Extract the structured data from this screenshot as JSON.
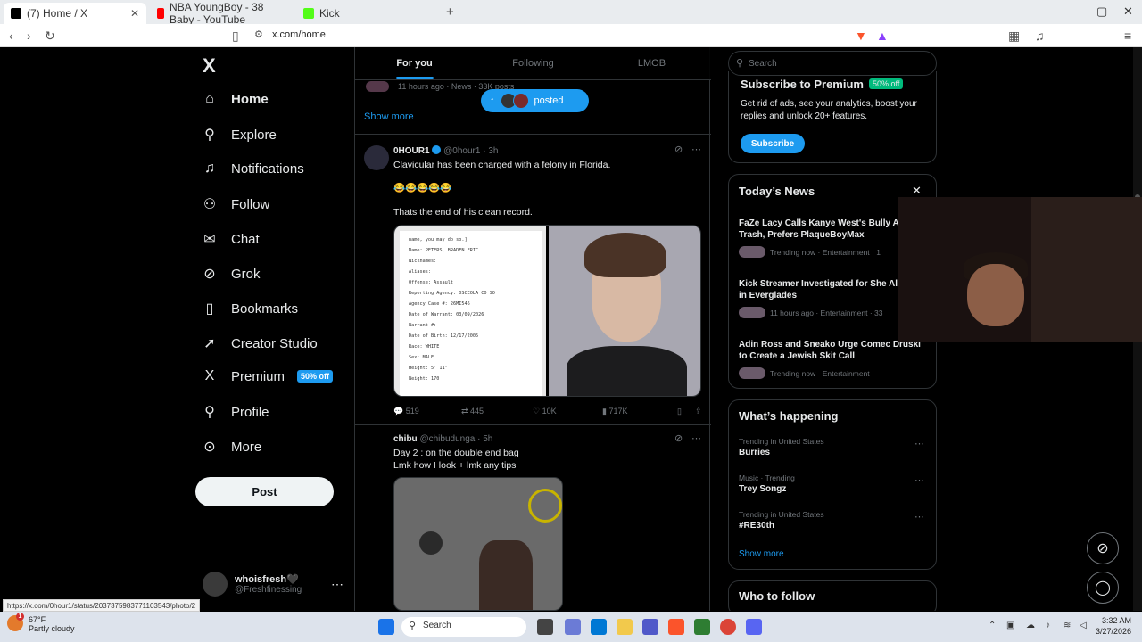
{
  "browser": {
    "tabs": [
      {
        "title": "(7) Home / X",
        "active": true,
        "favicon_color": "#000000"
      },
      {
        "title": "NBA YoungBoy - 38 Baby - YouTube",
        "active": false,
        "favicon_color": "#ff0000"
      },
      {
        "title": "Kick",
        "active": false,
        "favicon_color": "#53fc18"
      }
    ],
    "url": "x.com/home",
    "status_url": "https://x.com/0hour1/status/2037375983771103543/photo/2"
  },
  "sidebar": {
    "logo": "X",
    "items": [
      {
        "label": "Home",
        "icon": "home-icon",
        "glyph": "⌂",
        "bold": true
      },
      {
        "label": "Explore",
        "icon": "search-icon",
        "glyph": "⚲"
      },
      {
        "label": "Notifications",
        "icon": "bell-icon",
        "glyph": "🔔"
      },
      {
        "label": "Follow",
        "icon": "follow-icon",
        "glyph": "👤"
      },
      {
        "label": "Chat",
        "icon": "mail-icon",
        "glyph": "✉"
      },
      {
        "label": "Grok",
        "icon": "grok-icon",
        "glyph": "⊘"
      },
      {
        "label": "Bookmarks",
        "icon": "bookmark-icon",
        "glyph": "🔖"
      },
      {
        "label": "Creator Studio",
        "icon": "rocket-icon",
        "glyph": "🚀"
      },
      {
        "label": "Premium",
        "icon": "x-icon",
        "glyph": "X",
        "badge": "50% off"
      },
      {
        "label": "Profile",
        "icon": "profile-icon",
        "glyph": "👤"
      },
      {
        "label": "More",
        "icon": "more-icon",
        "glyph": "⋯"
      }
    ],
    "post_label": "Post",
    "user": {
      "name": "whoisfresh🖤",
      "handle": "@Freshfinessing"
    }
  },
  "timeline": {
    "tabs": [
      "For you",
      "Following",
      "LMOB"
    ],
    "prev_meta": "11 hours ago · News · 33K posts",
    "show_more": "Show more",
    "posted_pill": "posted",
    "tweets": [
      {
        "name": "0HOUR1",
        "handle": "@0hour1 · 3h",
        "lines": [
          "Clavicular has been charged with a felony in Florida.",
          "",
          "😂😂😂😂😂",
          "",
          "Thats the end of his clean record."
        ],
        "doc_lines": [
          "name, you may do so.]",
          "",
          "Name: PETERS, BRADEN ERIC",
          "Nicknames:",
          "Aliases:",
          "Offense: Assault",
          "Reporting Agency: OSCEOLA CO SO",
          "Agency Case #: 26MI546",
          "Date of Warrant: 03/09/2026",
          "Warrant #:",
          "Date of Birth: 12/17/2005",
          "Race: WHITE",
          "Sex: MALE",
          "Height: 5' 11\"",
          "Weight: 170"
        ],
        "stats": {
          "replies": "519",
          "reposts": "445",
          "likes": "10K",
          "views": "717K"
        }
      },
      {
        "name": "chibu",
        "handle": "@chibudunga · 5h",
        "lines": [
          "Day 2 : on the double end bag",
          "Lmk how I look + lmk any tips"
        ]
      }
    ]
  },
  "right": {
    "search_placeholder": "Search",
    "premium": {
      "title": "Subscribe to Premium",
      "badge": "50% off",
      "body": "Get rid of ads, see your analytics, boost your replies and unlock 20+ features.",
      "button": "Subscribe"
    },
    "news": {
      "title": "Today’s News",
      "items": [
        {
          "headline": "FaZe Lacy Calls Kanye West's Bully Album Trash, Prefers PlaqueBoyMax",
          "meta": "Trending now · Entertainment · 1"
        },
        {
          "headline": "Kick Streamer Investigated for She Alligator in Everglades",
          "meta": "11 hours ago · Entertainment · 33"
        },
        {
          "headline": "Adin Ross and Sneako Urge Comec Druski to Create a Jewish Skit Call",
          "meta": "Trending now · Entertainment ·"
        }
      ]
    },
    "happening": {
      "title": "What’s happening",
      "trends": [
        {
          "category": "Trending in United States",
          "name": "Burries"
        },
        {
          "category": "Music · Trending",
          "name": "Trey Songz"
        },
        {
          "category": "Trending in United States",
          "name": "#RE30th"
        }
      ],
      "show_more": "Show more"
    },
    "who_to_follow": "Who to follow"
  },
  "taskbar": {
    "weather_temp": "67°F",
    "weather_desc": "Partly cloudy",
    "weather_badge": "1",
    "search": "Search",
    "time": "3:32 AM",
    "date": "3/27/2026"
  }
}
